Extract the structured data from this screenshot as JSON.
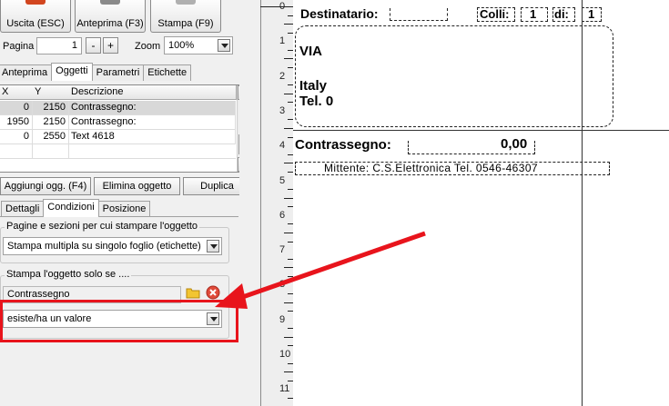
{
  "toolbar": {
    "exit_label": "Uscita (ESC)",
    "preview_label": "Anteprima (F3)",
    "print_label": "Stampa (F9)"
  },
  "pager": {
    "page_label": "Pagina",
    "page_value": "1",
    "minus": "-",
    "plus": "+",
    "zoom_label": "Zoom",
    "zoom_value": "100%"
  },
  "main_tabs": [
    "Anteprima",
    "Oggetti",
    "Parametri",
    "Etichette"
  ],
  "grid": {
    "headers": [
      "X",
      "Y",
      "Descrizione"
    ],
    "rows": [
      {
        "x": "0",
        "y": "2150",
        "desc": "Contrassegno:"
      },
      {
        "x": "1950",
        "y": "2150",
        "desc": "Contrassegno:"
      },
      {
        "x": "0",
        "y": "2550",
        "desc": "Text 4618"
      }
    ]
  },
  "actions": {
    "add": "Aggiungi ogg. (F4)",
    "delete": "Elimina oggetto",
    "duplicate": "Duplica"
  },
  "sub_tabs": [
    "Dettagli",
    "Condizioni",
    "Posizione"
  ],
  "conditions": {
    "pages_group_title": "Pagine e sezioni per cui stampare l'oggetto",
    "pages_value": "Stampa multipla su singolo foglio (etichette)",
    "only_if_group_title": "Stampa l'oggetto solo se ....",
    "field_value": "Contrassegno",
    "operator_value": "esiste/ha un valore"
  },
  "ruler": [
    "0",
    "1",
    "2",
    "3",
    "4",
    "5",
    "6",
    "7",
    "8",
    "9",
    "10",
    "11"
  ],
  "label_preview": {
    "recipient": "Destinatario:",
    "colli_label": "Colli:",
    "colli_value": "1",
    "di_label": "di:",
    "di_value": "1",
    "address_via": "VIA",
    "address_country": "Italy",
    "address_tel": "Tel. 0",
    "cod_label": "Contrassegno:",
    "cod_value": "0,00",
    "sender": "Mittente: C.S.Elettronica Tel. 0546-46307"
  },
  "colors": {
    "highlight": "#e8141c",
    "selected_row": "#d8d8d8"
  }
}
